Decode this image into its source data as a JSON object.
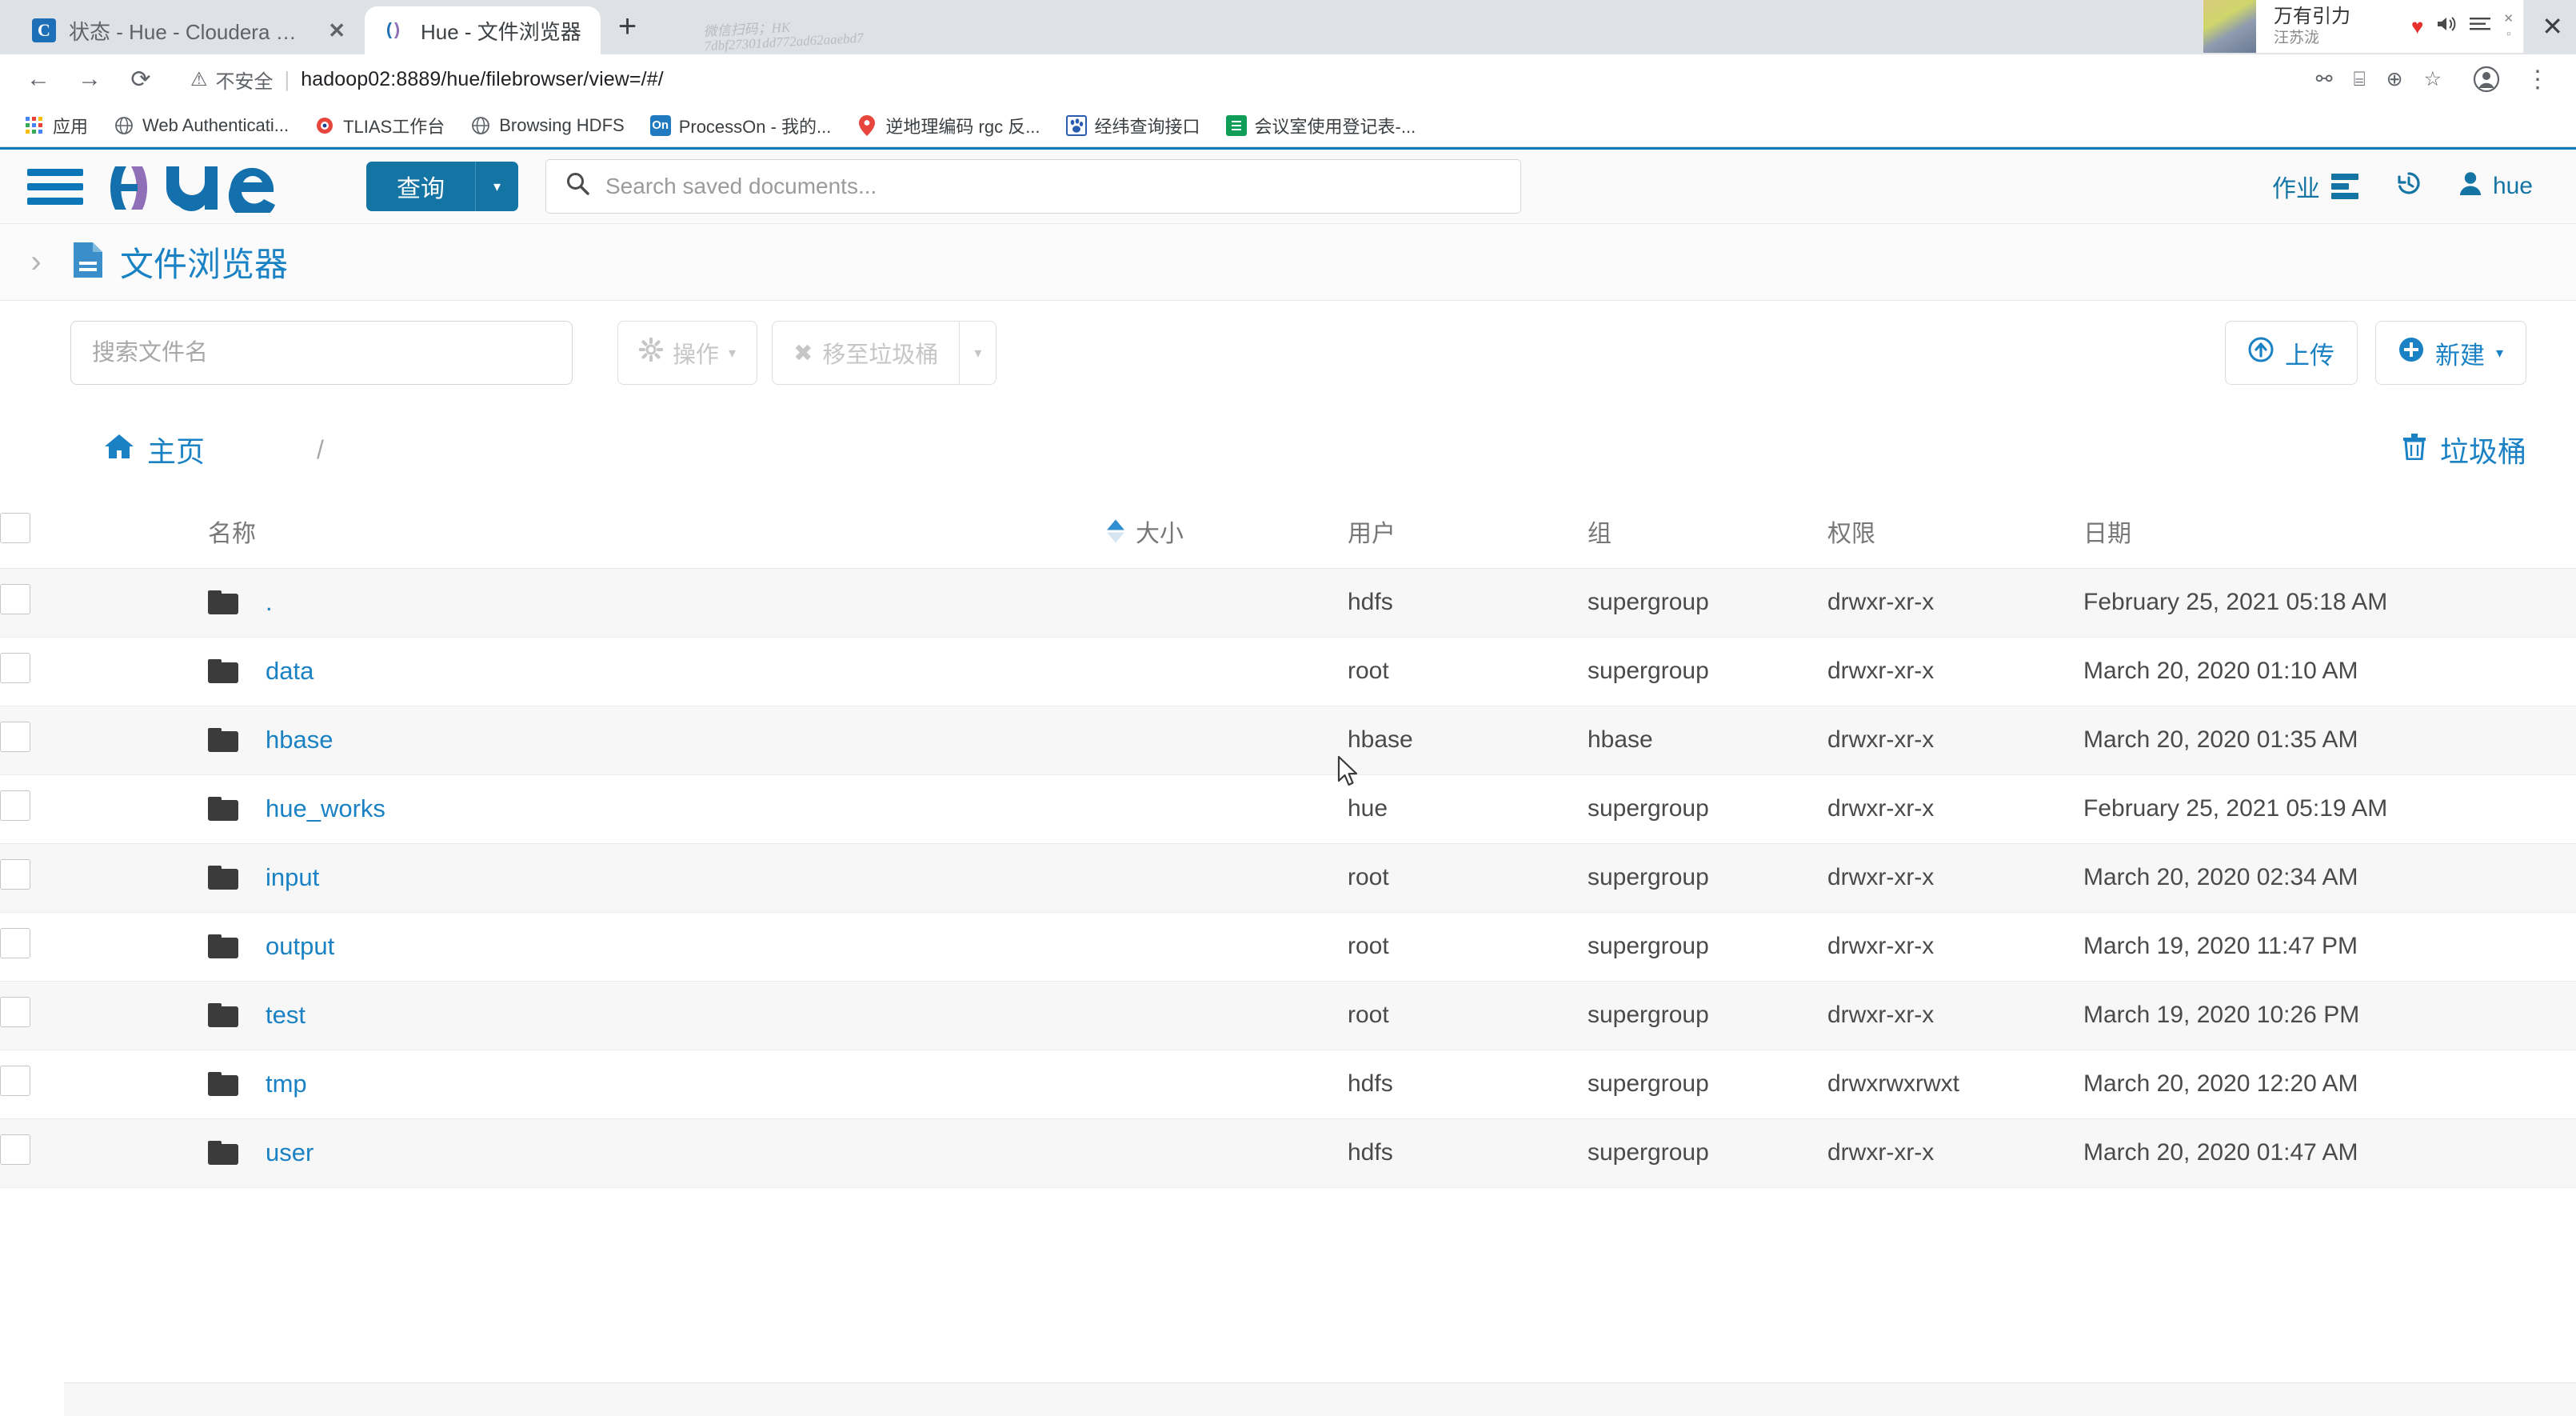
{
  "browser": {
    "tabs": [
      {
        "title": "状态 - Hue - Cloudera Manage",
        "favicon": "C",
        "active": false,
        "close": "✕"
      },
      {
        "title": "Hue - 文件浏览器",
        "favicon": "H",
        "active": true,
        "close": ""
      }
    ],
    "new_tab_label": "+",
    "watermark_line1": "微信扫码；HK",
    "watermark_line2": "7dbf27301dd772ad62aaebd7",
    "nav": {
      "back": "←",
      "forward": "→",
      "reload": "⟳"
    },
    "omnibox": {
      "security_label": "不安全",
      "security_icon": "⚠",
      "separator": "|",
      "url": "hadoop02:8889/hue/filebrowser/view=/#/",
      "right_icons": [
        "⚯",
        "⌸",
        "⊕",
        "☆"
      ],
      "profile_icon": "●"
    },
    "bookmarks": [
      {
        "label": "应用",
        "icon": "apps-grid-icon"
      },
      {
        "label": "Web Authenticati...",
        "icon": "globe-icon"
      },
      {
        "label": "TLIAS工作台",
        "icon": "tlias-icon"
      },
      {
        "label": "Browsing HDFS",
        "icon": "globe-icon"
      },
      {
        "label": "ProcessOn - 我的...",
        "icon": "processon-icon"
      },
      {
        "label": "逆地理编码 rgc 反...",
        "icon": "map-pin-icon"
      },
      {
        "label": "经纬查询接口",
        "icon": "baidu-paw-icon"
      },
      {
        "label": "会议室使用登记表-...",
        "icon": "sheets-icon"
      }
    ],
    "window_close": "✕"
  },
  "mini_player": {
    "title": "万有引力",
    "artist": "汪苏泷",
    "heart_icon": "♥",
    "speaker_icon": "🔊",
    "list_icon": "☰",
    "minimize_icon": "✕",
    "restore_icon": "▫"
  },
  "hue": {
    "logo_text": "hue",
    "query_button": {
      "label": "查询",
      "caret": "▾"
    },
    "search": {
      "placeholder": "Search saved documents...",
      "value": "",
      "icon": "search-icon"
    },
    "topbar_right": {
      "jobs_label": "作业",
      "history_icon": "↺",
      "user_label": "hue",
      "user_icon": "person-icon"
    },
    "page": {
      "title": "文件浏览器",
      "side_chevron": "›",
      "doc_icon": "document-icon"
    },
    "toolbar": {
      "file_search_placeholder": "搜索文件名",
      "file_search_value": "",
      "actions_label": "操作",
      "actions_icon": "gear-icon",
      "trash_label": "移至垃圾桶",
      "trash_icon": "✖",
      "caret": "▾",
      "upload_label": "上传",
      "upload_icon": "⬆",
      "new_label": "新建",
      "new_icon": "✚"
    },
    "breadcrumb": {
      "home_label": "主页",
      "home_icon": "home-icon",
      "separator": "/",
      "trash_label": "垃圾桶",
      "trash_icon": "trash-icon"
    },
    "accent_color": "#1a82c4",
    "brand_blue": "#0a7ab8"
  },
  "table": {
    "columns": [
      {
        "key": "check",
        "label": ""
      },
      {
        "key": "name",
        "label": "名称",
        "sorted": true,
        "sort_dir": "asc"
      },
      {
        "key": "size",
        "label": "大小"
      },
      {
        "key": "user",
        "label": "用户"
      },
      {
        "key": "group",
        "label": "组"
      },
      {
        "key": "perm",
        "label": "权限"
      },
      {
        "key": "date",
        "label": "日期"
      }
    ],
    "rows": [
      {
        "name": ".",
        "size": "",
        "user": "hdfs",
        "group": "supergroup",
        "perm": "drwxr-xr-x",
        "date": "February 25, 2021 05:18 AM"
      },
      {
        "name": "data",
        "size": "",
        "user": "root",
        "group": "supergroup",
        "perm": "drwxr-xr-x",
        "date": "March 20, 2020 01:10 AM"
      },
      {
        "name": "hbase",
        "size": "",
        "user": "hbase",
        "group": "hbase",
        "perm": "drwxr-xr-x",
        "date": "March 20, 2020 01:35 AM"
      },
      {
        "name": "hue_works",
        "size": "",
        "user": "hue",
        "group": "supergroup",
        "perm": "drwxr-xr-x",
        "date": "February 25, 2021 05:19 AM"
      },
      {
        "name": "input",
        "size": "",
        "user": "root",
        "group": "supergroup",
        "perm": "drwxr-xr-x",
        "date": "March 20, 2020 02:34 AM"
      },
      {
        "name": "output",
        "size": "",
        "user": "root",
        "group": "supergroup",
        "perm": "drwxr-xr-x",
        "date": "March 19, 2020 11:47 PM"
      },
      {
        "name": "test",
        "size": "",
        "user": "root",
        "group": "supergroup",
        "perm": "drwxr-xr-x",
        "date": "March 19, 2020 10:26 PM"
      },
      {
        "name": "tmp",
        "size": "",
        "user": "hdfs",
        "group": "supergroup",
        "perm": "drwxrwxrwxt",
        "date": "March 20, 2020 12:20 AM"
      },
      {
        "name": "user",
        "size": "",
        "user": "hdfs",
        "group": "supergroup",
        "perm": "drwxr-xr-x",
        "date": "March 20, 2020 01:47 AM"
      }
    ]
  }
}
